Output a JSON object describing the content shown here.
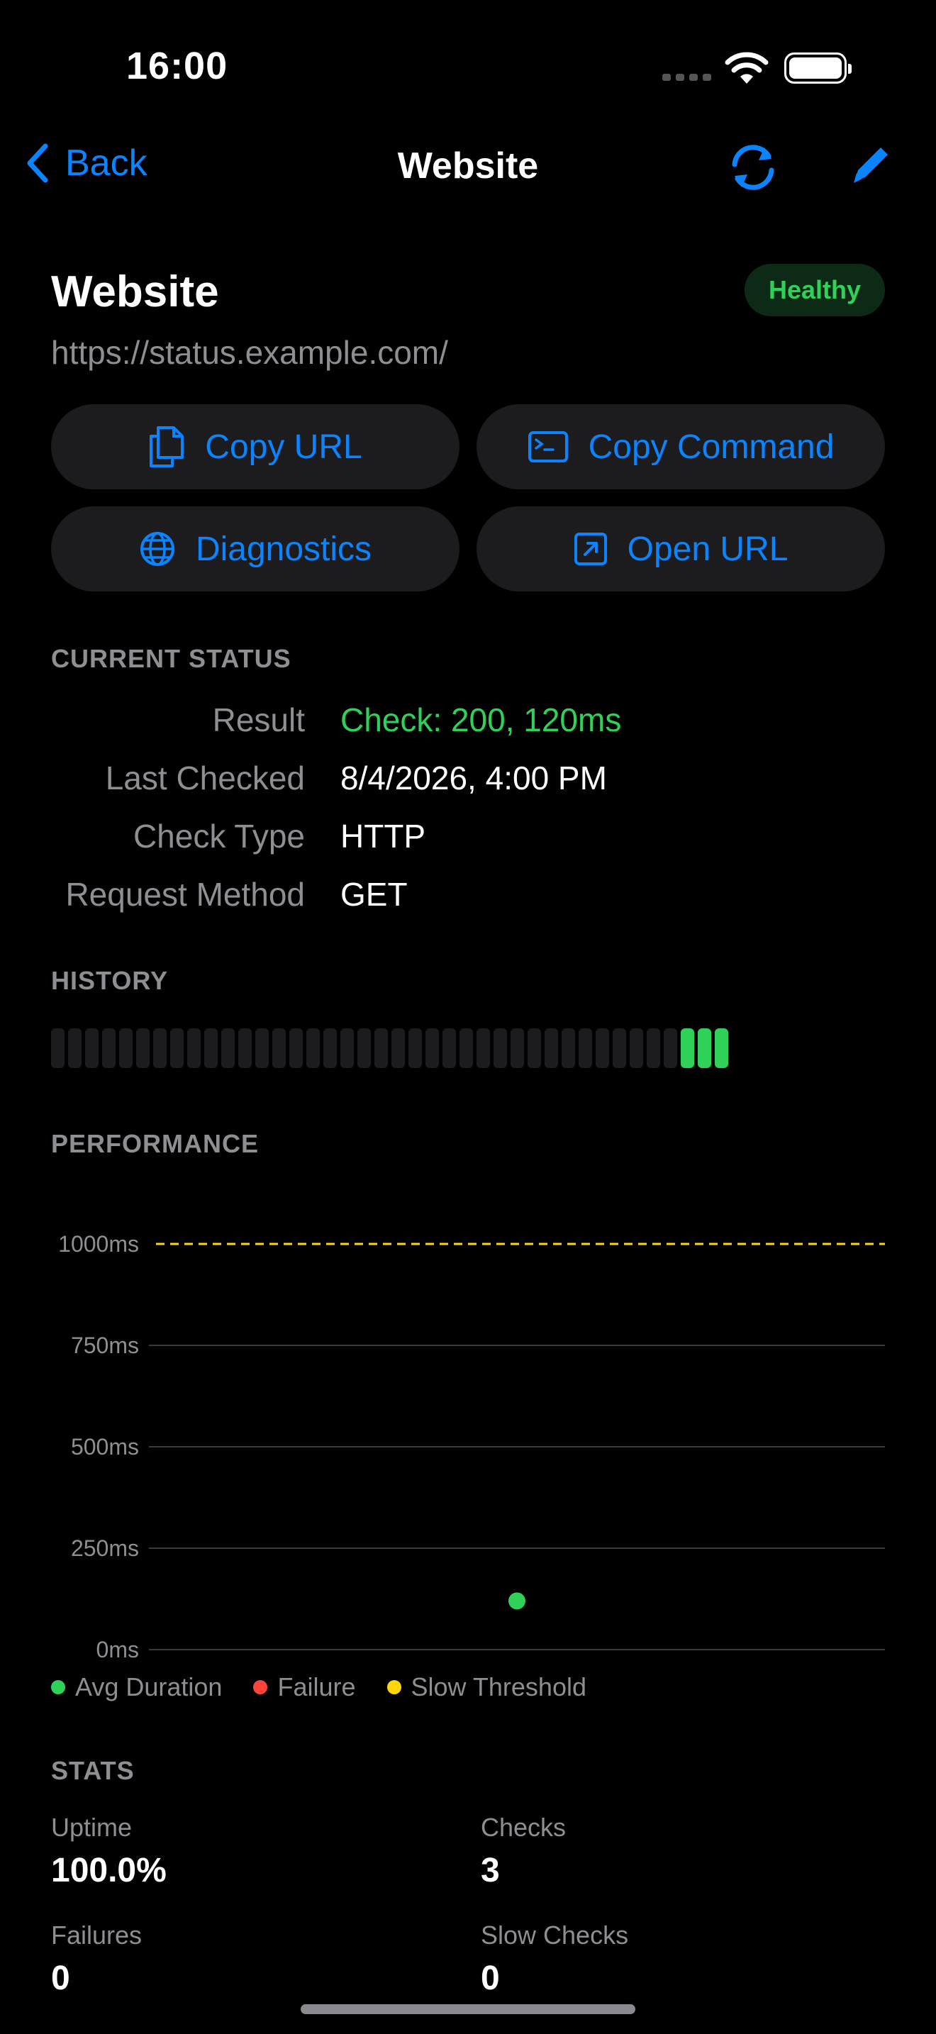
{
  "status_bar": {
    "time": "16:00"
  },
  "nav": {
    "back_label": "Back",
    "title": "Website"
  },
  "monitor": {
    "name": "Website",
    "status": "Healthy",
    "url": "https://status.example.com/"
  },
  "actions": {
    "copy_url": "Copy URL",
    "copy_command": "Copy Command",
    "diagnostics": "Diagnostics",
    "open_url": "Open URL"
  },
  "current_status": {
    "header": "CURRENT STATUS",
    "rows": [
      {
        "key": "Result",
        "value": "Check: 200, 120ms"
      },
      {
        "key": "Last Checked",
        "value": "8/4/2026, 4:00 PM"
      },
      {
        "key": "Check Type",
        "value": "HTTP"
      },
      {
        "key": "Request Method",
        "value": "GET"
      }
    ]
  },
  "history": {
    "header": "HISTORY",
    "states": [
      "none",
      "none",
      "none",
      "none",
      "none",
      "none",
      "none",
      "none",
      "none",
      "none",
      "none",
      "none",
      "none",
      "none",
      "none",
      "none",
      "none",
      "none",
      "none",
      "none",
      "none",
      "none",
      "none",
      "none",
      "none",
      "none",
      "none",
      "none",
      "none",
      "none",
      "none",
      "none",
      "none",
      "none",
      "none",
      "none",
      "none",
      "ok",
      "ok",
      "ok"
    ]
  },
  "performance": {
    "header": "PERFORMANCE"
  },
  "chart_data": {
    "type": "scatter",
    "ylim": [
      0,
      1000
    ],
    "y_ticks": [
      0,
      250,
      500,
      750,
      1000
    ],
    "tick_labels": [
      "0ms",
      "250ms",
      "500ms",
      "750ms",
      "1000ms"
    ],
    "slow_threshold": 1000,
    "points": [
      {
        "x": 0.5,
        "y": 120
      }
    ],
    "x_range": [
      0,
      1
    ],
    "legend": [
      "Avg Duration",
      "Failure",
      "Slow Threshold"
    ],
    "legend_placement": "bottom",
    "colors": {
      "avg": "#30d158",
      "failure": "#ff453a",
      "threshold": "#ffd60a"
    },
    "grid": true
  },
  "stats": {
    "header": "STATS",
    "items": [
      {
        "label": "Uptime",
        "value": "100.0%"
      },
      {
        "label": "Checks",
        "value": "3"
      },
      {
        "label": "Failures",
        "value": "0"
      },
      {
        "label": "Slow Checks",
        "value": "0"
      }
    ]
  },
  "colors": {
    "accent": "#0a84ff",
    "success": "#30d158",
    "background": "#000000",
    "card": "#1c1c1e"
  }
}
